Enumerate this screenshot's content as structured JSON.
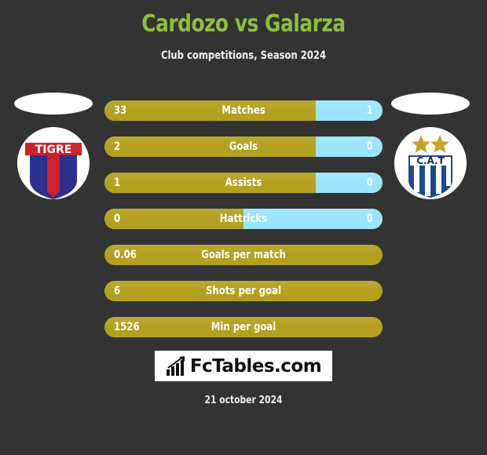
{
  "header": {
    "title": "Cardozo vs Galarza",
    "subtitle": "Club competitions, Season 2024",
    "title_color": "#8dbf40",
    "subtitle_color": "#f2f2f2"
  },
  "theme": {
    "background": "#333333",
    "home_color": "#b3a01e",
    "away_color": "#9ae5fc",
    "text_color": "#ffffff"
  },
  "badges": {
    "home": {
      "name": "tigre-badge",
      "club_text": "TIGRE",
      "colors": {
        "banner": "#cc2229",
        "shield_side": "#2d2f8f",
        "shield_center": "#cc2229",
        "ring": "#ffffff"
      }
    },
    "away": {
      "name": "talleres-badge",
      "club_text": "C.A.T",
      "stars": 2,
      "colors": {
        "stripe": "#1c4a8f",
        "star": "#c9a227",
        "ring": "#ffffff"
      }
    }
  },
  "footer": {
    "logo_text": "FcTables.com",
    "logo_icon": "bar-chart-arrow-icon",
    "date": "21 october 2024"
  },
  "chart_data": {
    "type": "bar",
    "title": "Cardozo vs Galarza",
    "subtitle": "Club competitions, Season 2024",
    "orientation": "horizontal-diverging",
    "series": [
      {
        "name": "Cardozo",
        "color": "#b3a01e",
        "side": "left"
      },
      {
        "name": "Galarza",
        "color": "#9ae5fc",
        "side": "right"
      }
    ],
    "categories": [
      "Matches",
      "Goals",
      "Assists",
      "Hattricks",
      "Goals per match",
      "Shots per goal",
      "Min per goal"
    ],
    "rows": [
      {
        "label": "Matches",
        "home_value": "33",
        "away_value": "1",
        "home_num": 33,
        "away_num": 1,
        "home_pct": 76,
        "split": true
      },
      {
        "label": "Goals",
        "home_value": "2",
        "away_value": "0",
        "home_num": 2,
        "away_num": 0,
        "home_pct": 76,
        "split": true
      },
      {
        "label": "Assists",
        "home_value": "1",
        "away_value": "0",
        "home_num": 1,
        "away_num": 0,
        "home_pct": 76,
        "split": true
      },
      {
        "label": "Hattricks",
        "home_value": "0",
        "away_value": "0",
        "home_num": 0,
        "away_num": 0,
        "home_pct": 50,
        "split": true
      },
      {
        "label": "Goals per match",
        "home_value": "0.06",
        "away_value": "",
        "home_num": 0.06,
        "away_num": null,
        "home_pct": 100,
        "split": false
      },
      {
        "label": "Shots per goal",
        "home_value": "6",
        "away_value": "",
        "home_num": 6,
        "away_num": null,
        "home_pct": 100,
        "split": false
      },
      {
        "label": "Min per goal",
        "home_value": "1526",
        "away_value": "",
        "home_num": 1526,
        "away_num": null,
        "home_pct": 100,
        "split": false
      }
    ]
  }
}
